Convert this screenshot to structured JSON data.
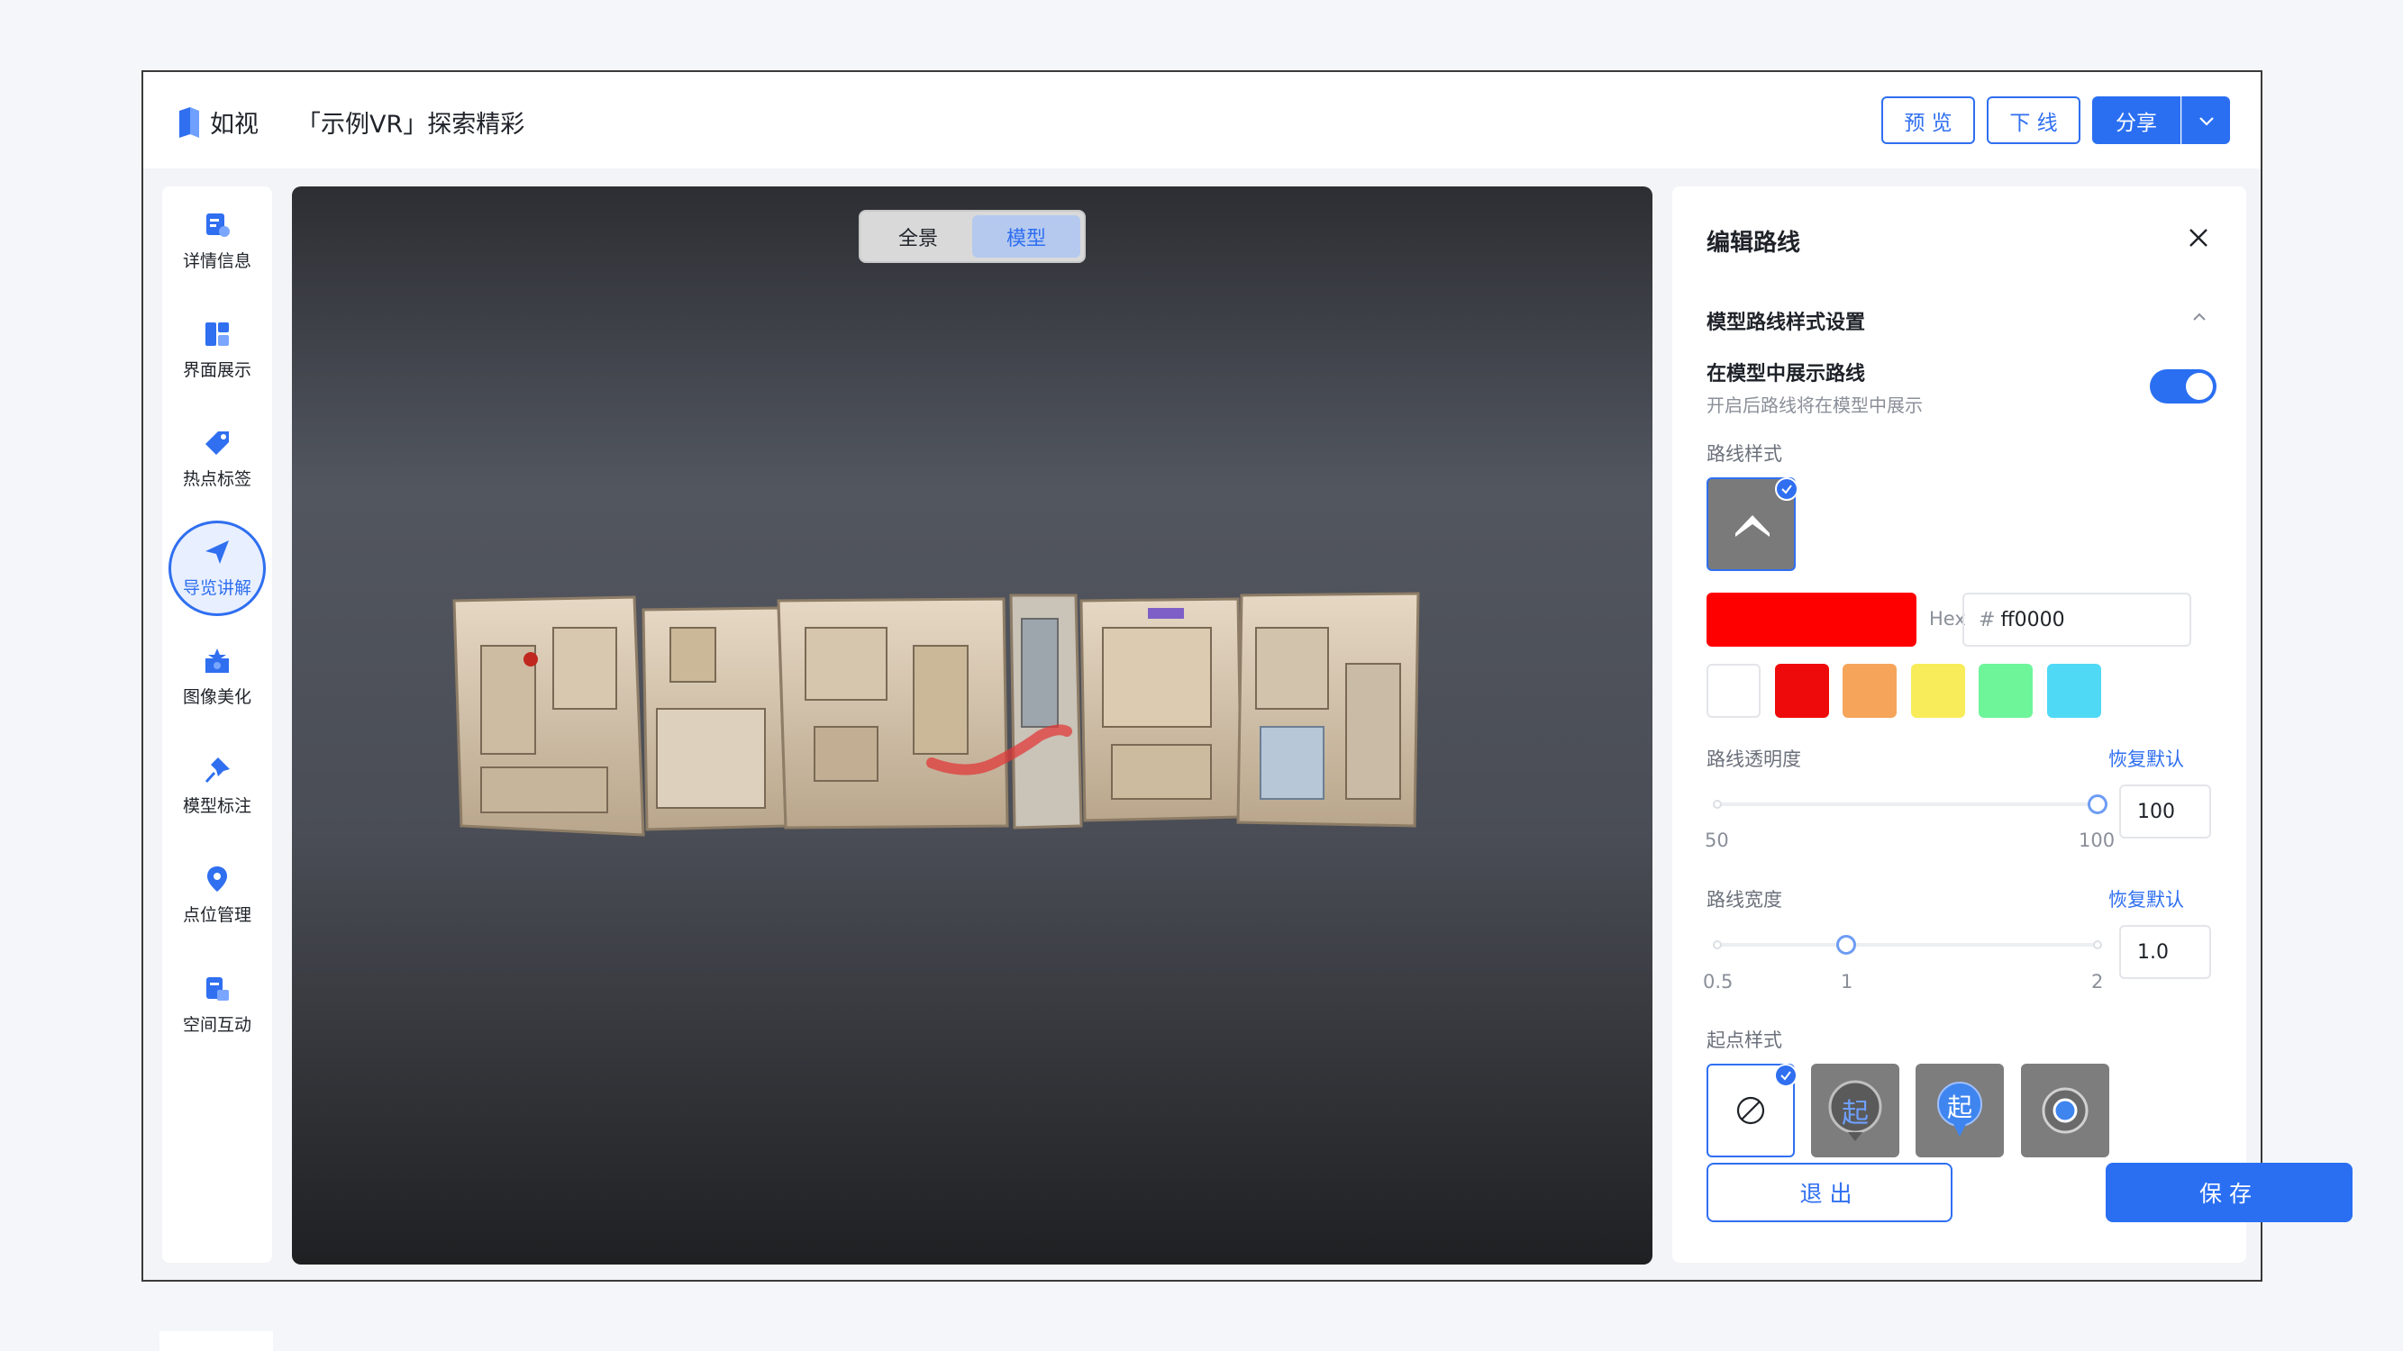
{
  "app": {
    "logo_text": "如视",
    "doc_title": "「示例VR」探索精彩"
  },
  "topbar": {
    "preview_label": "预 览",
    "offline_label": "下 线",
    "share_label": "分享"
  },
  "sidebar": {
    "items": [
      {
        "label": "详情信息",
        "icon": "details-icon"
      },
      {
        "label": "界面展示",
        "icon": "layout-icon"
      },
      {
        "label": "热点标签",
        "icon": "tag-icon"
      },
      {
        "label": "导览讲解",
        "icon": "navigation-icon",
        "active": true
      },
      {
        "label": "图像美化",
        "icon": "image-beautify-icon"
      },
      {
        "label": "模型标注",
        "icon": "pin-icon"
      },
      {
        "label": "点位管理",
        "icon": "location-icon"
      },
      {
        "label": "空间互动",
        "icon": "interaction-icon"
      }
    ]
  },
  "viewer": {
    "tabs": [
      "全景",
      "模型"
    ],
    "active_tab": "模型"
  },
  "panel": {
    "title": "编辑路线",
    "section_title": "模型路线样式设置",
    "show_route_title": "在模型中展示路线",
    "show_route_desc": "开启后路线将在模型中展示",
    "show_route_enabled": true,
    "route_style_label": "路线样式",
    "hex_label": "Hex",
    "hex_value": "ff0000",
    "current_color": "#ff0000",
    "swatches": [
      "#ffffff",
      "#ee0a0a",
      "#f5a45a",
      "#f8ec5a",
      "#6ef59a",
      "#50d9f5"
    ],
    "opacity": {
      "label": "路线透明度",
      "reset": "恢复默认",
      "min": "50",
      "max": "100",
      "value": "100"
    },
    "width": {
      "label": "路线宽度",
      "reset": "恢复默认",
      "min": "0.5",
      "mid": "1",
      "max": "2",
      "value": "1.0"
    },
    "start_style_label": "起点样式",
    "start_glyph": "起",
    "exit_label": "退出",
    "save_label": "保存"
  }
}
